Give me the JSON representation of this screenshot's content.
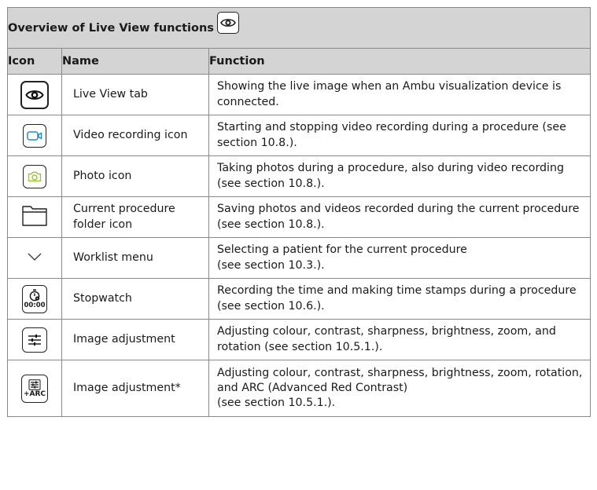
{
  "table": {
    "title": "Overview of Live View functions",
    "title_icon": "eye-icon",
    "headers": {
      "icon": "Icon",
      "name": "Name",
      "function": "Function"
    },
    "rows": [
      {
        "icon": "eye-icon",
        "name": "Live View tab",
        "function": "Showing the live image when an Ambu visualization device is connected."
      },
      {
        "icon": "video-camera-icon",
        "name": "Video recording icon",
        "function": "Starting and stopping video recording during a procedure (see section 10.8.)."
      },
      {
        "icon": "photo-camera-icon",
        "name": "Photo icon",
        "function": "Taking photos during a procedure, also during video recording (see section 10.8.)."
      },
      {
        "icon": "folder-icon",
        "name": "Current procedure folder icon",
        "function": "Saving photos and videos recorded during the current procedure (see section 10.8.)."
      },
      {
        "icon": "chevron-down-icon",
        "name": "Worklist menu",
        "function_line1": "Selecting a patient for the current procedure",
        "function_line2": "(see section 10.3.)."
      },
      {
        "icon": "stopwatch-icon",
        "icon_text": "00:00",
        "name": "Stopwatch",
        "function": "Recording the time and making time stamps during a procedure (see section 10.6.)."
      },
      {
        "icon": "sliders-icon",
        "name": "Image adjustment",
        "function": "Adjusting colour, contrast, sharpness, brightness, zoom, and rotation (see section 10.5.1.)."
      },
      {
        "icon": "sliders-arc-icon",
        "icon_text": "+ARC",
        "name": "Image adjustment*",
        "function_line1": "Adjusting colour, contrast, sharpness, brightness, zoom, rotation, and ARC (Advanced Red Contrast)",
        "function_line2": "(see section 10.5.1.)."
      }
    ]
  },
  "colors": {
    "header_bg": "#d4d4d4",
    "video_icon": "#1f8fc7",
    "photo_icon": "#9cc43c",
    "border": "#8a8a8a"
  }
}
